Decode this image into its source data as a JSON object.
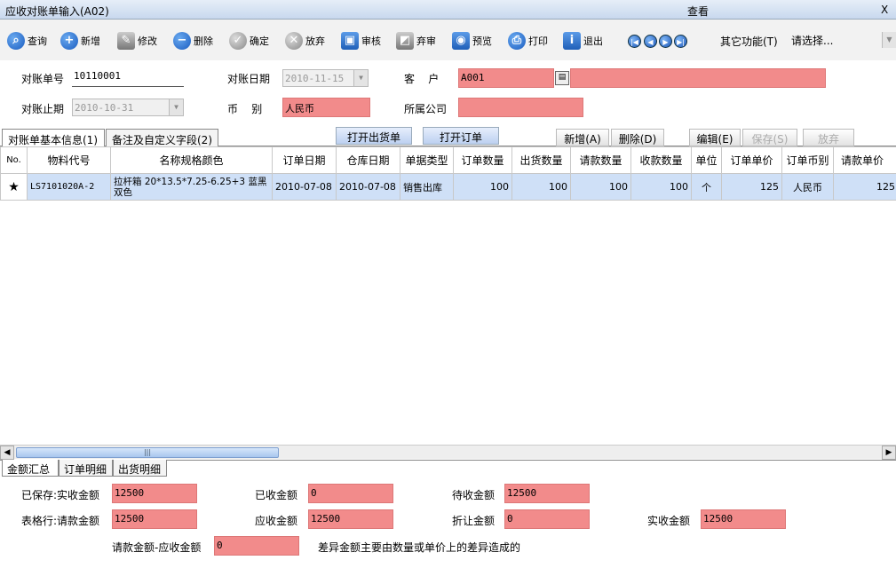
{
  "window": {
    "title": "应收对账单输入(A02)",
    "mode": "查看",
    "close": "X"
  },
  "toolbar": [
    {
      "label": "查询",
      "icon": "search-icon"
    },
    {
      "label": "新增",
      "icon": "plus-icon"
    },
    {
      "label": "修改",
      "icon": "pencil-icon"
    },
    {
      "label": "删除",
      "icon": "minus-icon"
    },
    {
      "label": "确定",
      "icon": "check-icon"
    },
    {
      "label": "放弃",
      "icon": "x-icon"
    },
    {
      "label": "审核",
      "icon": "audit-icon"
    },
    {
      "label": "弃审",
      "icon": "unaudit-icon"
    },
    {
      "label": "预览",
      "icon": "preview-icon"
    },
    {
      "label": "打印",
      "icon": "print-icon"
    },
    {
      "label": "退出",
      "icon": "exit-icon"
    }
  ],
  "other": {
    "label": "其它功能(T)",
    "value": "请选择..."
  },
  "form": {
    "no_label": "对账单号",
    "no_value": "10110001",
    "date_label": "对账日期",
    "date_value": "2010-11-15",
    "cust_label": "客    户",
    "cust_code": "A001",
    "end_label": "对账止期",
    "end_value": "2010-10-31",
    "cur_label": "币    别",
    "cur_value": "人民币",
    "comp_label": "所属公司",
    "comp_value": ""
  },
  "tabs": [
    "对账单基本信息(1)",
    "备注及自定义字段(2)"
  ],
  "buttons": {
    "open_ship": "打开出货单",
    "open_order": "打开订单",
    "add": "新增(A)",
    "del": "删除(D)",
    "edit": "编辑(E)",
    "save": "保存(S)",
    "discard": "放弃"
  },
  "grid": {
    "headers": [
      "No.",
      "物料代号",
      "名称规格颜色",
      "订单日期",
      "仓库日期",
      "单据类型",
      "订单数量",
      "出货数量",
      "请款数量",
      "收款数量",
      "单位",
      "订单单价",
      "订单币别",
      "请款单价"
    ],
    "rows": [
      [
        "★",
        "LS7101020A-2",
        "拉杆箱 20*13.5*7.25-6.25+3 蓝黑双色",
        "2010-07-08",
        "2010-07-08",
        "销售出库",
        "100",
        "100",
        "100",
        "100",
        "个",
        "125",
        "人民币",
        "125"
      ]
    ]
  },
  "bottom_tabs": [
    "金额汇总",
    "订单明细",
    "出货明细"
  ],
  "summary": {
    "r1": [
      {
        "l": "已保存:实收金额",
        "v": "12500"
      },
      {
        "l": "已收金额",
        "v": "0"
      },
      {
        "l": "待收金额",
        "v": "12500"
      }
    ],
    "r2": [
      {
        "l": "表格行:请款金额",
        "v": "12500"
      },
      {
        "l": "应收金额",
        "v": "12500"
      },
      {
        "l": "折让金额",
        "v": "0"
      },
      {
        "l": "实收金额",
        "v": "12500"
      }
    ],
    "diff_label": "请款金额-应收金额",
    "diff_value": "0",
    "note": "差异金额主要由数量或单价上的差异造成的"
  }
}
